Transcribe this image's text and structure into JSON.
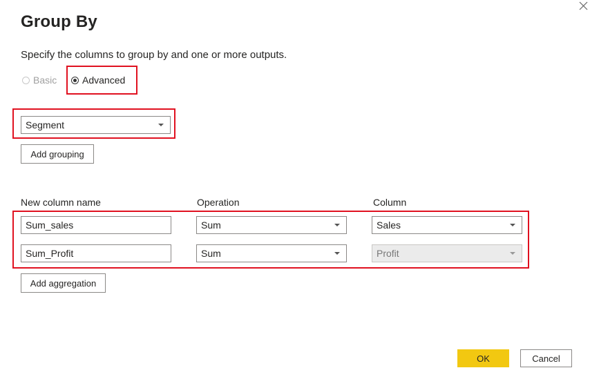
{
  "dialog": {
    "title": "Group By",
    "subtitle": "Specify the columns to group by and one or more outputs.",
    "close_icon": "close-icon"
  },
  "mode": {
    "basic_label": "Basic",
    "advanced_label": "Advanced",
    "selected": "Advanced"
  },
  "grouping": {
    "selected_column": "Segment",
    "add_grouping_label": "Add grouping"
  },
  "aggregations": {
    "headers": {
      "new_column_name": "New column name",
      "operation": "Operation",
      "column": "Column"
    },
    "rows": [
      {
        "name": "Sum_sales",
        "operation": "Sum",
        "column": "Sales",
        "column_disabled": false
      },
      {
        "name": "Sum_Profit",
        "operation": "Sum",
        "column": "Profit",
        "column_disabled": true
      }
    ],
    "add_aggregation_label": "Add aggregation"
  },
  "footer": {
    "ok_label": "OK",
    "cancel_label": "Cancel"
  },
  "colors": {
    "highlight": "#e0101f",
    "primary_button": "#f2c811"
  }
}
